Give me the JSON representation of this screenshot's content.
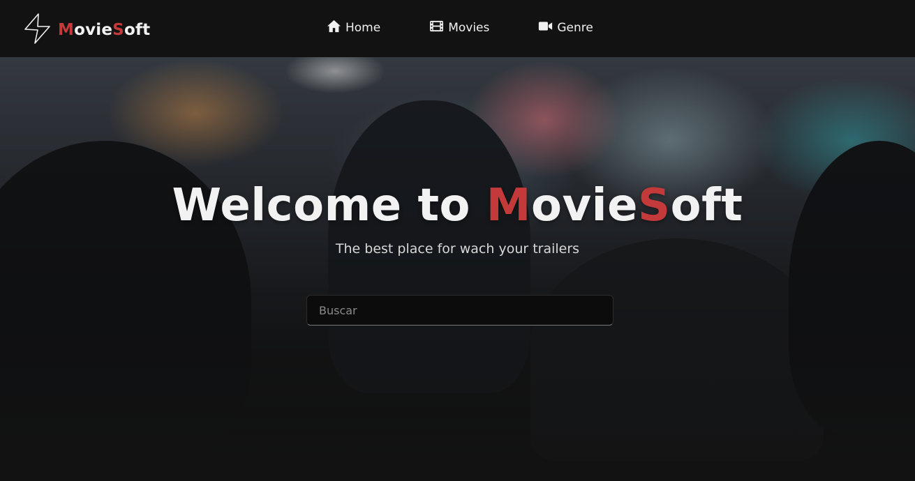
{
  "brand": {
    "logo_icon": "lightning-bolt-icon",
    "name_parts": [
      {
        "text": "M",
        "color": "#c43a3a"
      },
      {
        "text": "ovie",
        "color": "#f2f2f2"
      },
      {
        "text": "S",
        "color": "#c43a3a"
      },
      {
        "text": "oft",
        "color": "#f2f2f2"
      }
    ]
  },
  "nav": {
    "items": [
      {
        "label": "Home",
        "icon": "home-icon"
      },
      {
        "label": "Movies",
        "icon": "film-icon"
      },
      {
        "label": "Genre",
        "icon": "video-camera-icon"
      }
    ]
  },
  "hero": {
    "title_prefix": "Welcome to ",
    "title_parts": [
      {
        "text": "M",
        "color": "#c43a3a"
      },
      {
        "text": "ovie",
        "color": "#f2f2f2"
      },
      {
        "text": "S",
        "color": "#c43a3a"
      },
      {
        "text": "oft",
        "color": "#f2f2f2"
      }
    ],
    "subtitle": "The best place for wach your trailers",
    "search_placeholder": "Buscar",
    "search_value": ""
  },
  "colors": {
    "accent": "#c43a3a",
    "navbar_bg": "#121212",
    "text": "#f2f2f2"
  }
}
